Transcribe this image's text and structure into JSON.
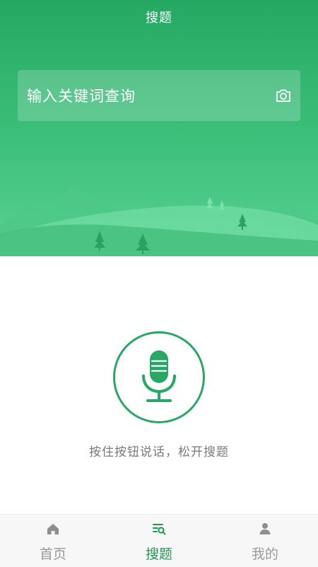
{
  "header": {
    "title": "搜题"
  },
  "search": {
    "placeholder": "输入关键词查询",
    "camera_icon": "camera-icon"
  },
  "voice": {
    "mic_icon": "microphone-icon",
    "hint": "按住按钮说话，松开搜题"
  },
  "tabbar": {
    "active_index": 1,
    "tabs": [
      {
        "label": "首页",
        "icon": "home-icon"
      },
      {
        "label": "搜题",
        "icon": "search-list-icon"
      },
      {
        "label": "我的",
        "icon": "user-icon"
      }
    ]
  },
  "colors": {
    "primary_green": "#24a862",
    "light_green": "#5ad192",
    "active_tab": "#1f9a55",
    "inactive_tab": "#9a9a9a"
  }
}
